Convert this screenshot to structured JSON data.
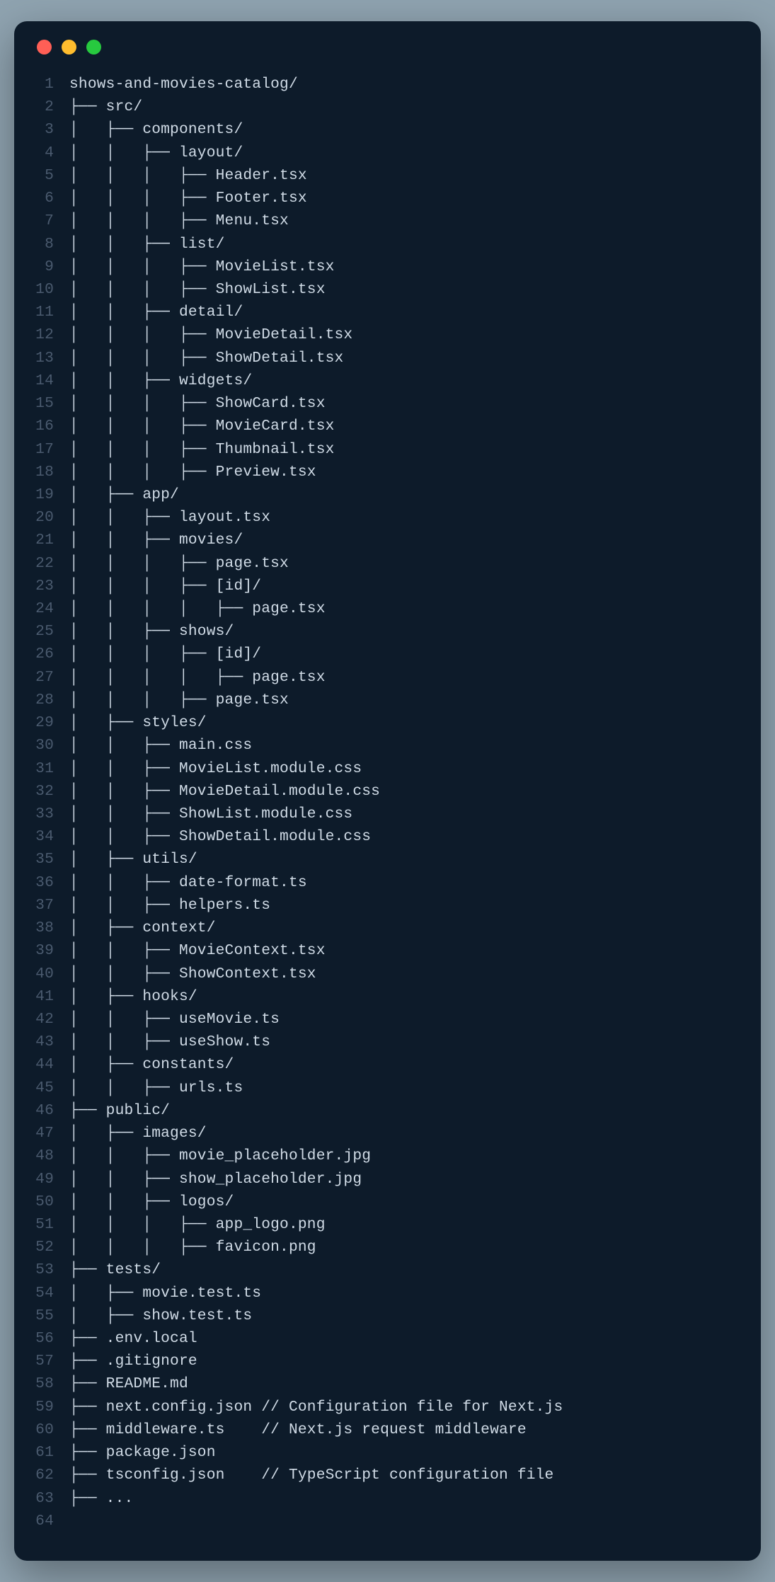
{
  "window": {
    "traffic_lights": [
      "red",
      "yellow",
      "green"
    ]
  },
  "code_lines": [
    {
      "n": 1,
      "t": "shows-and-movies-catalog/"
    },
    {
      "n": 2,
      "t": "├── src/"
    },
    {
      "n": 3,
      "t": "│   ├── components/"
    },
    {
      "n": 4,
      "t": "│   │   ├── layout/"
    },
    {
      "n": 5,
      "t": "│   │   │   ├── Header.tsx"
    },
    {
      "n": 6,
      "t": "│   │   │   ├── Footer.tsx"
    },
    {
      "n": 7,
      "t": "│   │   │   ├── Menu.tsx"
    },
    {
      "n": 8,
      "t": "│   │   ├── list/"
    },
    {
      "n": 9,
      "t": "│   │   │   ├── MovieList.tsx"
    },
    {
      "n": 10,
      "t": "│   │   │   ├── ShowList.tsx"
    },
    {
      "n": 11,
      "t": "│   │   ├── detail/"
    },
    {
      "n": 12,
      "t": "│   │   │   ├── MovieDetail.tsx"
    },
    {
      "n": 13,
      "t": "│   │   │   ├── ShowDetail.tsx"
    },
    {
      "n": 14,
      "t": "│   │   ├── widgets/"
    },
    {
      "n": 15,
      "t": "│   │   │   ├── ShowCard.tsx"
    },
    {
      "n": 16,
      "t": "│   │   │   ├── MovieCard.tsx"
    },
    {
      "n": 17,
      "t": "│   │   │   ├── Thumbnail.tsx"
    },
    {
      "n": 18,
      "t": "│   │   │   ├── Preview.tsx"
    },
    {
      "n": 19,
      "t": "│   ├── app/"
    },
    {
      "n": 20,
      "t": "│   │   ├── layout.tsx"
    },
    {
      "n": 21,
      "t": "│   │   ├── movies/"
    },
    {
      "n": 22,
      "t": "│   │   │   ├── page.tsx"
    },
    {
      "n": 23,
      "t": "│   │   │   ├── [id]/"
    },
    {
      "n": 24,
      "t": "│   │   │   │   ├── page.tsx"
    },
    {
      "n": 25,
      "t": "│   │   ├── shows/"
    },
    {
      "n": 26,
      "t": "│   │   │   ├── [id]/"
    },
    {
      "n": 27,
      "t": "│   │   │   │   ├── page.tsx"
    },
    {
      "n": 28,
      "t": "│   │   │   ├── page.tsx"
    },
    {
      "n": 29,
      "t": "│   ├── styles/"
    },
    {
      "n": 30,
      "t": "│   │   ├── main.css"
    },
    {
      "n": 31,
      "t": "│   │   ├── MovieList.module.css"
    },
    {
      "n": 32,
      "t": "│   │   ├── MovieDetail.module.css"
    },
    {
      "n": 33,
      "t": "│   │   ├── ShowList.module.css"
    },
    {
      "n": 34,
      "t": "│   │   ├── ShowDetail.module.css"
    },
    {
      "n": 35,
      "t": "│   ├── utils/"
    },
    {
      "n": 36,
      "t": "│   │   ├── date-format.ts"
    },
    {
      "n": 37,
      "t": "│   │   ├── helpers.ts"
    },
    {
      "n": 38,
      "t": "│   ├── context/"
    },
    {
      "n": 39,
      "t": "│   │   ├── MovieContext.tsx"
    },
    {
      "n": 40,
      "t": "│   │   ├── ShowContext.tsx"
    },
    {
      "n": 41,
      "t": "│   ├── hooks/"
    },
    {
      "n": 42,
      "t": "│   │   ├── useMovie.ts"
    },
    {
      "n": 43,
      "t": "│   │   ├── useShow.ts"
    },
    {
      "n": 44,
      "t": "│   ├── constants/"
    },
    {
      "n": 45,
      "t": "│   │   ├── urls.ts"
    },
    {
      "n": 46,
      "t": "├── public/"
    },
    {
      "n": 47,
      "t": "│   ├── images/"
    },
    {
      "n": 48,
      "t": "│   │   ├── movie_placeholder.jpg"
    },
    {
      "n": 49,
      "t": "│   │   ├── show_placeholder.jpg"
    },
    {
      "n": 50,
      "t": "│   │   ├── logos/"
    },
    {
      "n": 51,
      "t": "│   │   │   ├── app_logo.png"
    },
    {
      "n": 52,
      "t": "│   │   │   ├── favicon.png"
    },
    {
      "n": 53,
      "t": "├── tests/"
    },
    {
      "n": 54,
      "t": "│   ├── movie.test.ts"
    },
    {
      "n": 55,
      "t": "│   ├── show.test.ts"
    },
    {
      "n": 56,
      "t": "├── .env.local"
    },
    {
      "n": 57,
      "t": "├── .gitignore"
    },
    {
      "n": 58,
      "t": "├── README.md"
    },
    {
      "n": 59,
      "t": "├── next.config.json // Configuration file for Next.js"
    },
    {
      "n": 60,
      "t": "├── middleware.ts    // Next.js request middleware"
    },
    {
      "n": 61,
      "t": "├── package.json"
    },
    {
      "n": 62,
      "t": "├── tsconfig.json    // TypeScript configuration file"
    },
    {
      "n": 63,
      "t": "├── ..."
    },
    {
      "n": 64,
      "t": ""
    }
  ]
}
